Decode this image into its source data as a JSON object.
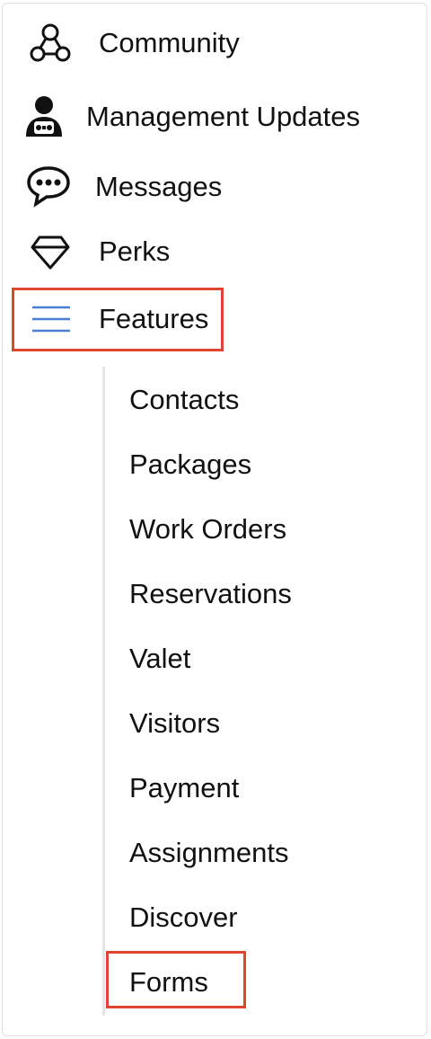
{
  "nav": {
    "items": [
      {
        "label": "Community",
        "icon": "community-icon"
      },
      {
        "label": "Management Updates",
        "icon": "management-person-icon"
      },
      {
        "label": "Messages",
        "icon": "chat-bubble-icon"
      },
      {
        "label": "Perks",
        "icon": "diamond-icon"
      },
      {
        "label": "Features",
        "icon": "hamburger-menu-icon"
      }
    ]
  },
  "features_submenu": {
    "items": [
      {
        "label": "Contacts"
      },
      {
        "label": "Packages"
      },
      {
        "label": "Work Orders"
      },
      {
        "label": "Reservations"
      },
      {
        "label": "Valet"
      },
      {
        "label": "Visitors"
      },
      {
        "label": "Payment"
      },
      {
        "label": "Assignments"
      },
      {
        "label": "Discover"
      },
      {
        "label": "Forms"
      }
    ]
  },
  "colors": {
    "highlight": "#e0452f",
    "menu_icon_accent": "#4a7fd4",
    "text": "#111111"
  }
}
